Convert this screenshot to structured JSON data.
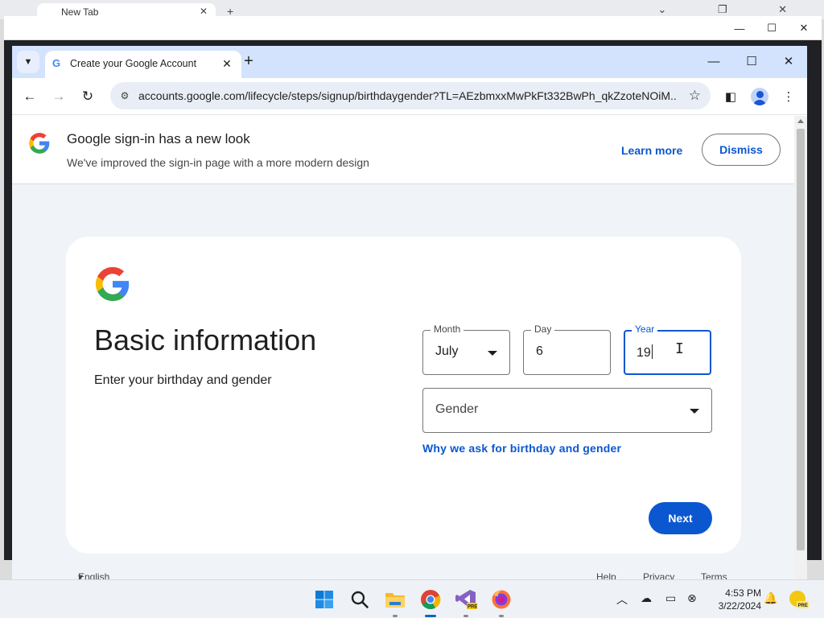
{
  "background_window": {
    "tab_title": "New Tab"
  },
  "browser": {
    "tab": {
      "title": "Create your Google Account"
    },
    "address_bar": {
      "url": "accounts.google.com/lifecycle/steps/signup/birthdaygender?TL=AEzbmxxMwPkFt332BwPh_qkZzoteNOiM..."
    }
  },
  "banner": {
    "title": "Google sign-in has a new look",
    "subtitle": "We've improved the sign-in page with a more modern design",
    "learn_more": "Learn more",
    "dismiss": "Dismiss"
  },
  "form": {
    "heading": "Basic information",
    "subheading": "Enter your birthday and gender",
    "month": {
      "label": "Month",
      "value": "July"
    },
    "day": {
      "label": "Day",
      "value": "6"
    },
    "year": {
      "label": "Year",
      "value": "19"
    },
    "gender": {
      "placeholder": "Gender"
    },
    "why_link": "Why we ask for birthday and gender",
    "next_button": "Next"
  },
  "footer": {
    "language": "English (United States)",
    "help": "Help",
    "privacy": "Privacy",
    "terms": "Terms"
  },
  "taskbar": {
    "time": "4:53 PM",
    "date": "3/22/2024",
    "badge": "PRE"
  },
  "colors": {
    "accent_blue": "#0b57d0",
    "page_background": "#f0f4f9",
    "tabstrip": "#d3e3fd"
  }
}
